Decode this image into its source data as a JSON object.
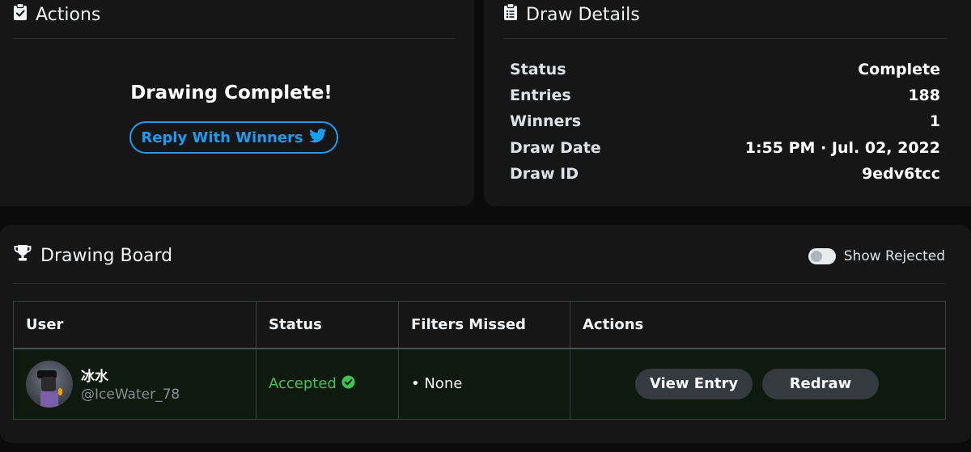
{
  "actions": {
    "title": "Actions",
    "complete_text": "Drawing Complete!",
    "reply_label": "Reply With Winners"
  },
  "details": {
    "title": "Draw Details",
    "rows": [
      {
        "label": "Status",
        "value": "Complete"
      },
      {
        "label": "Entries",
        "value": "188"
      },
      {
        "label": "Winners",
        "value": "1"
      },
      {
        "label": "Draw Date",
        "value": "1:55 PM · Jul. 02, 2022"
      },
      {
        "label": "Draw ID",
        "value": "9edv6tcc"
      }
    ]
  },
  "board": {
    "title": "Drawing Board",
    "toggle_label": "Show Rejected",
    "toggle_on": false,
    "columns": [
      "User",
      "Status",
      "Filters Missed",
      "Actions"
    ],
    "rows": [
      {
        "display_name": "冰水",
        "handle": "@IceWater_78",
        "status": "Accepted",
        "filters_missed": "• None",
        "view_label": "View Entry",
        "redraw_label": "Redraw"
      }
    ]
  },
  "colors": {
    "accent": "#1d9bf0",
    "accepted": "#40c057",
    "panel": "#161616",
    "background": "#0b0b0b"
  }
}
